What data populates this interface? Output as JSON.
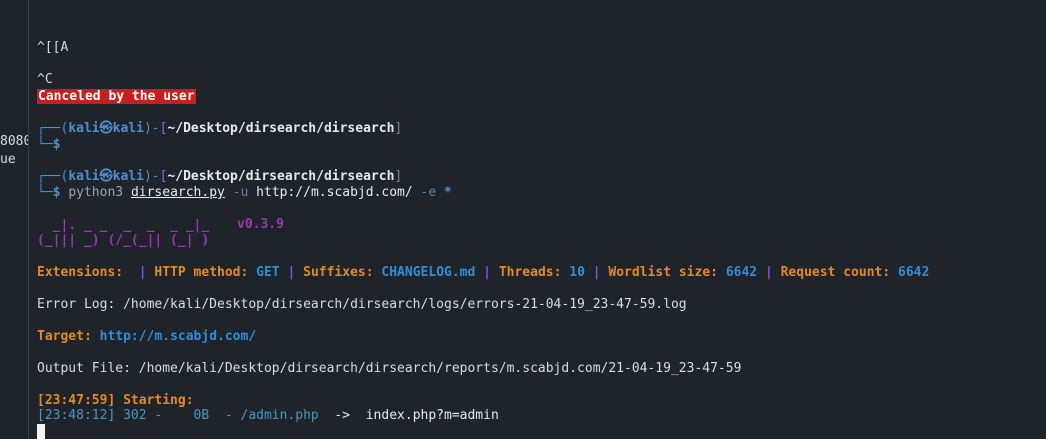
{
  "gutter": {
    "line1": "8080",
    "line2": "ue"
  },
  "terminal": {
    "keystroke_line": "^[[A",
    "interrupt_line": "^C",
    "canceled_message": "Canceled by the user",
    "prompt1": {
      "frame_top": "┌──(",
      "user": "kali㉿kali",
      "mid": ")-[",
      "path": "~/Desktop/dirsearch/dirsearch",
      "close": "]",
      "frame_bottom": "└─$"
    },
    "prompt2": {
      "frame_top": "┌──(",
      "user": "kali㉿kali",
      "mid": ")-[",
      "path": "~/Desktop/dirsearch/dirsearch",
      "close": "]",
      "frame_bottom": "└─$",
      "cmd_program": "python3",
      "cmd_file": "dirsearch.py",
      "cmd_flag_u": "-u",
      "cmd_url": "http://m.scabjd.com/",
      "cmd_flag_e": "-e",
      "cmd_ext": "*"
    },
    "banner": {
      "art_line1": "  _|. _ _  _  _  _ _|_   ",
      "art_line2": "(_||| _) (/_(_|| (_| )  ",
      "version": "v0.3.9"
    },
    "config": {
      "extensions_label": "Extensions:",
      "extensions_value": "",
      "http_method_label": "HTTP method:",
      "http_method_value": "GET",
      "suffixes_label": "Suffixes:",
      "suffixes_value": "CHANGELOG.md",
      "threads_label": "Threads:",
      "threads_value": "10",
      "wordlist_label": "Wordlist size:",
      "wordlist_value": "6642",
      "request_label": "Request count:",
      "request_value": "6642",
      "separator": "|"
    },
    "error_log": "Error Log: /home/kali/Desktop/dirsearch/dirsearch/logs/errors-21-04-19_23-47-59.log",
    "target_label": "Target:",
    "target_value": "http://m.scabjd.com/",
    "output_file": "Output File: /home/kali/Desktop/dirsearch/dirsearch/reports/m.scabjd.com/21-04-19_23-47-59",
    "starting": "[23:47:59] Starting:",
    "result": {
      "text": "[23:48:12] 302 -    0B  - /admin.php",
      "arrow": "  ->  ",
      "redirect": "index.php?m=admin"
    }
  }
}
